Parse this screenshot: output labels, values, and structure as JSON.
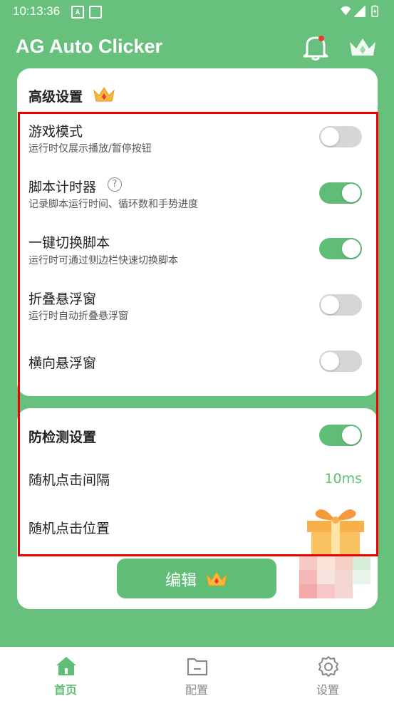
{
  "status_bar": {
    "time": "10:13:36",
    "icon_a": "A"
  },
  "app": {
    "title": "AG Auto Clicker"
  },
  "colors": {
    "primary": "#5fbd76",
    "background": "#67c17d",
    "highlight": "#e00000"
  },
  "advanced": {
    "title": "高级设置",
    "items": [
      {
        "title": "游戏模式",
        "subtitle": "运行时仅展示播放/暂停按钮",
        "on": false
      },
      {
        "title": "脚本计时器",
        "subtitle": "记录脚本运行时间、循环数和手势进度",
        "on": true,
        "help": "?"
      },
      {
        "title": "一键切换脚本",
        "subtitle": "运行时可通过侧边栏快速切换脚本",
        "on": true
      },
      {
        "title": "折叠悬浮窗",
        "subtitle": "运行时自动折叠悬浮窗",
        "on": false
      },
      {
        "title": "横向悬浮窗",
        "on": false
      }
    ]
  },
  "anti_detect": {
    "title": "防检测设置",
    "on": true,
    "interval_label": "随机点击间隔",
    "interval_value": "10ms",
    "position_label": "随机点击位置"
  },
  "edit_button": {
    "label": "编辑"
  },
  "nav": {
    "home": "首页",
    "config": "配置",
    "settings": "设置"
  }
}
